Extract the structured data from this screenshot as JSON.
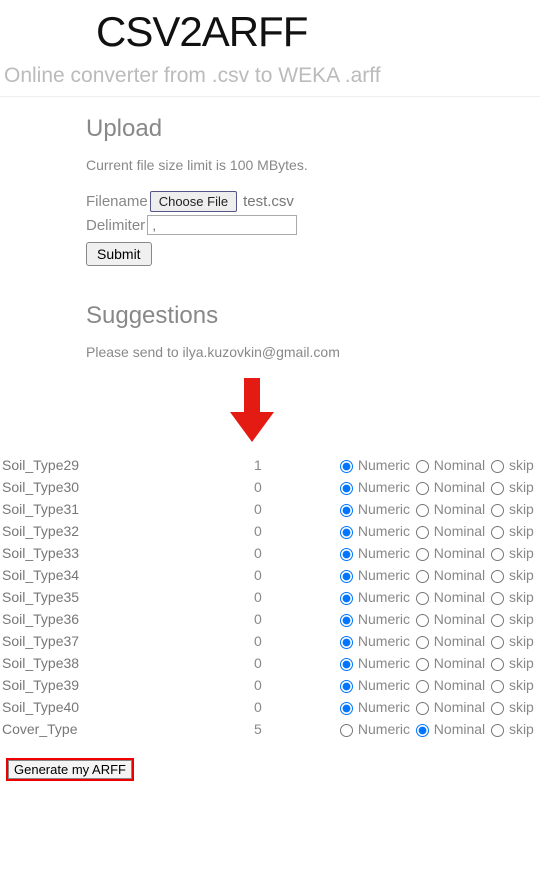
{
  "title": "CSV2ARFF",
  "subtitle": "Online converter from .csv to WEKA .arff",
  "upload": {
    "heading": "Upload",
    "limit_text": "Current file size limit is 100 MBytes.",
    "filename_label": "Filename",
    "choose_label": "Choose File",
    "chosen_file": "test.csv",
    "delimiter_label": "Delimiter",
    "delimiter_value": ",",
    "submit_label": "Submit"
  },
  "suggestions": {
    "heading": "Suggestions",
    "text": "Please send to ilya.kuzovkin@gmail.com"
  },
  "options": {
    "numeric_label": "Numeric",
    "nominal_label": "Nominal",
    "skip_label": "skip"
  },
  "attributes": [
    {
      "name": "Soil_Type29",
      "value": "1",
      "selected": "numeric"
    },
    {
      "name": "Soil_Type30",
      "value": "0",
      "selected": "numeric"
    },
    {
      "name": "Soil_Type31",
      "value": "0",
      "selected": "numeric"
    },
    {
      "name": "Soil_Type32",
      "value": "0",
      "selected": "numeric"
    },
    {
      "name": "Soil_Type33",
      "value": "0",
      "selected": "numeric"
    },
    {
      "name": "Soil_Type34",
      "value": "0",
      "selected": "numeric"
    },
    {
      "name": "Soil_Type35",
      "value": "0",
      "selected": "numeric"
    },
    {
      "name": "Soil_Type36",
      "value": "0",
      "selected": "numeric"
    },
    {
      "name": "Soil_Type37",
      "value": "0",
      "selected": "numeric"
    },
    {
      "name": "Soil_Type38",
      "value": "0",
      "selected": "numeric"
    },
    {
      "name": "Soil_Type39",
      "value": "0",
      "selected": "numeric"
    },
    {
      "name": "Soil_Type40",
      "value": "0",
      "selected": "numeric"
    },
    {
      "name": "Cover_Type",
      "value": "5",
      "selected": "nominal"
    }
  ],
  "generate_label": "Generate my ARFF",
  "arrow_color": "#e31b12"
}
